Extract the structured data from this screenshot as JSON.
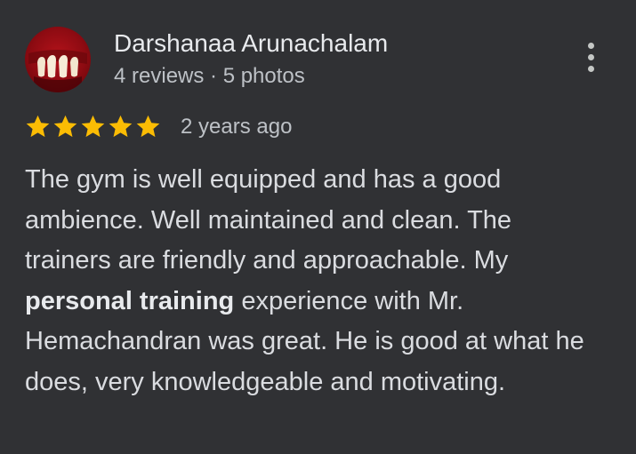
{
  "review": {
    "author_name": "Darshanaa Arunachalam",
    "author_meta": "4 reviews · 5 photos",
    "rating": 5,
    "rating_max": 5,
    "time_ago": "2 years ago",
    "text_before_highlight": "The gym is well equipped and has a good ambience. Well maintained and clean. The trainers are friendly and approachable. My ",
    "highlight": "personal training",
    "text_after_highlight": " experience with Mr. Hemachandran was great. He is good at what he does, very knowledgeable and motivating."
  },
  "icons": {
    "avatar": "profile-photo",
    "more": "more-vert-icon",
    "star": "star-icon"
  },
  "colors": {
    "background": "#303134",
    "star": "#fbbc04",
    "name": "#e8eaed",
    "meta": "#bdc1c6",
    "body": "#dadce0"
  }
}
